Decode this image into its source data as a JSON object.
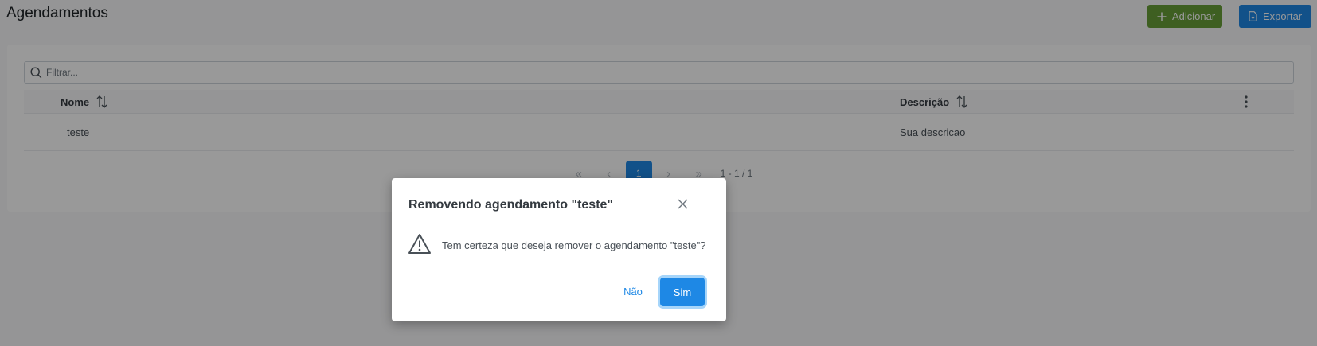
{
  "page": {
    "title": "Agendamentos"
  },
  "toolbar": {
    "add_label": "Adicionar",
    "export_label": "Exportar",
    "add_icon": "plus-icon",
    "export_icon": "file-export-icon",
    "add_color": "#689f38",
    "export_color": "#1e88e5"
  },
  "filter": {
    "placeholder": "Filtrar...",
    "value": ""
  },
  "table": {
    "columns": [
      {
        "label": "Nome"
      },
      {
        "label": "Descrição"
      }
    ],
    "rows": [
      {
        "name": "teste",
        "description": "Sua descricao"
      }
    ]
  },
  "pagination": {
    "current_page": "1",
    "info": "1 - 1 / 1"
  },
  "dialog": {
    "title": "Removendo agendamento \"teste\"",
    "message": "Tem certeza que deseja remover o agendamento \"teste\"?",
    "no_label": "Não",
    "yes_label": "Sim",
    "icon": "warning-triangle-icon"
  }
}
